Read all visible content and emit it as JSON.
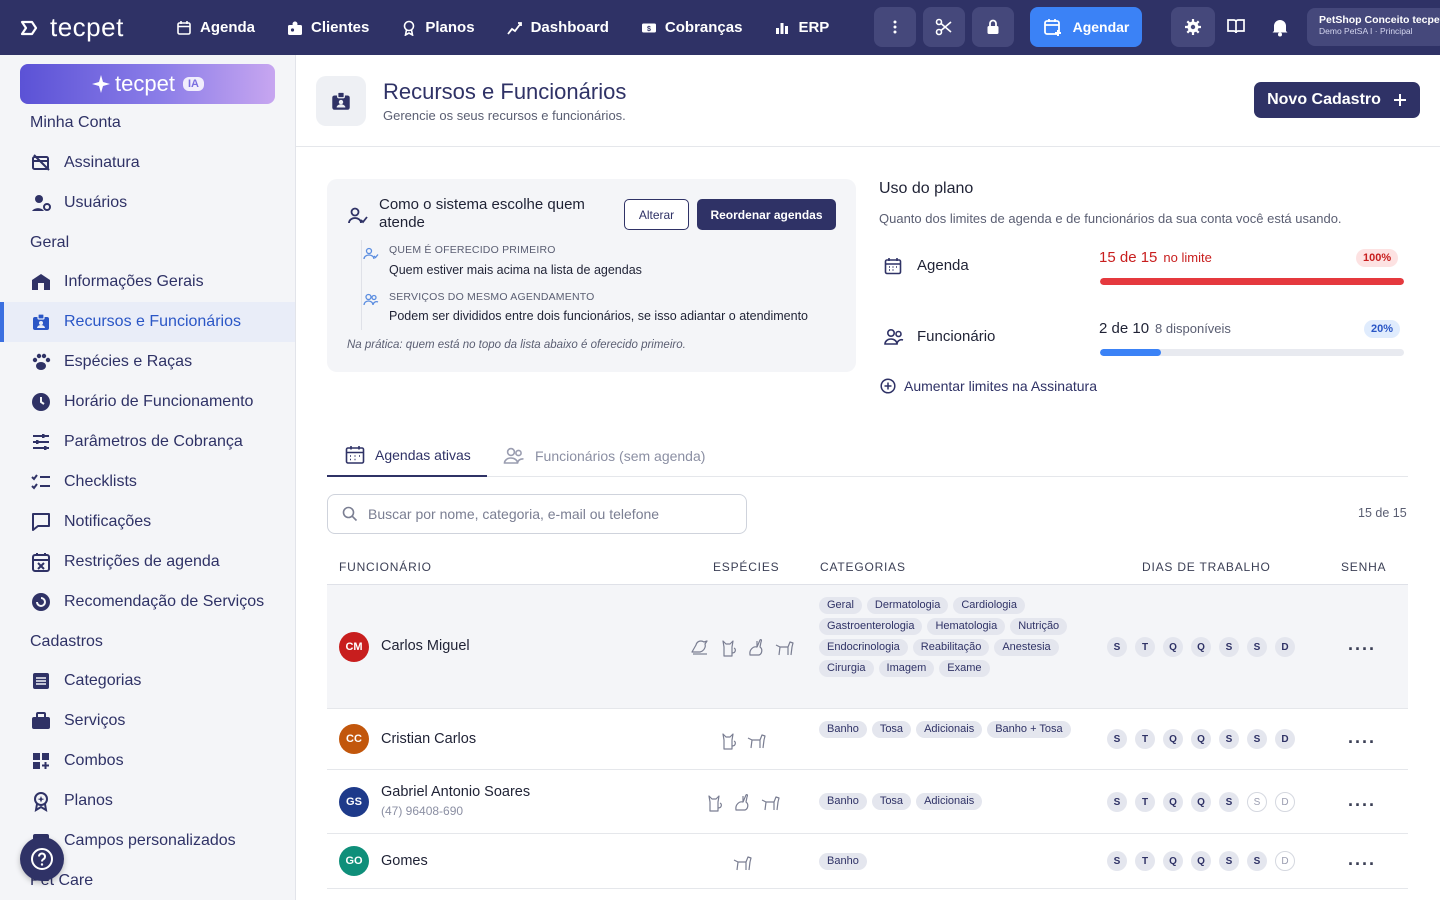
{
  "topbar": {
    "brand": "tecpet",
    "nav": [
      {
        "label": "Agenda",
        "icon": "calendar-icon"
      },
      {
        "label": "Clientes",
        "icon": "users-icon"
      },
      {
        "label": "Planos",
        "icon": "badge-icon"
      },
      {
        "label": "Dashboard",
        "icon": "chart-icon"
      },
      {
        "label": "Cobranças",
        "icon": "money-icon"
      },
      {
        "label": "ERP",
        "icon": "bars-icon"
      }
    ],
    "agendar_label": "Agendar",
    "account_name": "PetShop Conceito tecpet",
    "account_sub": "Demo PetSA I · Principal"
  },
  "sidebar": {
    "ia_brand": "tecpet",
    "ia_badge": "IA",
    "sections": [
      "Minha Conta",
      "Geral",
      "Cadastros",
      "Pet Care"
    ],
    "items": [
      {
        "label": "Assinatura"
      },
      {
        "label": "Usuários"
      },
      {
        "label": "Informações Gerais"
      },
      {
        "label": "Recursos e Funcionários"
      },
      {
        "label": "Espécies e Raças"
      },
      {
        "label": "Horário de Funcionamento"
      },
      {
        "label": "Parâmetros de Cobrança"
      },
      {
        "label": "Checklists"
      },
      {
        "label": "Notificações"
      },
      {
        "label": "Restrições de agenda"
      },
      {
        "label": "Recomendação de Serviços"
      },
      {
        "label": "Categorias"
      },
      {
        "label": "Serviços"
      },
      {
        "label": "Combos"
      },
      {
        "label": "Planos"
      },
      {
        "label": "Campos personalizados"
      }
    ]
  },
  "header": {
    "title": "Recursos e Funcionários",
    "subtitle": "Gerencie os seus recursos e funcionários.",
    "new_button": "Novo Cadastro"
  },
  "info": {
    "title": "Como o sistema escolhe quem atende",
    "alterar": "Alterar",
    "reordenar": "Reordenar agendas",
    "rows": [
      {
        "label": "QUEM É OFERECIDO PRIMEIRO",
        "value": "Quem estiver mais acima na lista de agendas"
      },
      {
        "label": "SERVIÇOS DO MESMO AGENDAMENTO",
        "value": "Podem ser divididos entre dois funcionários, se isso adiantar o atendimento"
      }
    ],
    "note": "Na prática: quem está no topo da lista abaixo é oferecido primeiro."
  },
  "plan": {
    "title": "Uso do plano",
    "subtitle": "Quanto dos limites de agenda e de funcionários da sua conta você está usando.",
    "rows": [
      {
        "label": "Agenda",
        "count": "15 de 15",
        "note": "no limite",
        "badge": "100%",
        "fraction": 1.0,
        "color": "#e5393e"
      },
      {
        "label": "Funcionário",
        "count": "2 de 10",
        "note": "8 disponíveis",
        "badge": "20%",
        "fraction": 0.2,
        "color": "#3b82f6"
      }
    ],
    "link": "Aumentar limites na Assinatura"
  },
  "tabs": [
    {
      "label": "Agendas ativas",
      "active": true
    },
    {
      "label": "Funcionários (sem agenda)",
      "active": false
    }
  ],
  "search": {
    "placeholder": "Buscar por nome, categoria, e-mail ou telefone",
    "value": ""
  },
  "count_label": "15 de 15",
  "table": {
    "headers": [
      "FUNCIONÁRIO",
      "ESPÉCIES",
      "CATEGORIAS",
      "DIAS DE TRABALHO",
      "SENHA"
    ],
    "day_letters": [
      "S",
      "T",
      "Q",
      "Q",
      "S",
      "S",
      "D"
    ],
    "rows": [
      {
        "initials": "CM",
        "avatar_color": "#c81e1e",
        "name": "Carlos Miguel",
        "phone": "",
        "species": [
          "bird-icon",
          "cat-icon",
          "rabbit-icon",
          "dog-icon"
        ],
        "categories": [
          "Geral",
          "Dermatologia",
          "Cardiologia",
          "Gastroenterologia",
          "Hematologia",
          "Nutrição",
          "Endocrinologia",
          "Reabilitação",
          "Anestesia",
          "Cirurgia",
          "Imagem",
          "Exame"
        ],
        "days_on": [
          true,
          true,
          true,
          true,
          true,
          true,
          true
        ],
        "more": "...."
      },
      {
        "initials": "CC",
        "avatar_color": "#c2570c",
        "name": "Cristian Carlos",
        "phone": "",
        "species": [
          "cat-icon",
          "dog-icon"
        ],
        "categories": [
          "Banho",
          "Tosa",
          "Adicionais",
          "Banho + Tosa"
        ],
        "days_on": [
          true,
          true,
          true,
          true,
          true,
          true,
          true
        ],
        "more": "...."
      },
      {
        "initials": "GS",
        "avatar_color": "#1e3a8a",
        "name": "Gabriel Antonio Soares",
        "phone": "(47) 96408-690",
        "species": [
          "cat-icon",
          "rabbit-icon",
          "dog-icon"
        ],
        "categories": [
          "Banho",
          "Tosa",
          "Adicionais"
        ],
        "days_on": [
          true,
          true,
          true,
          true,
          true,
          false,
          false
        ],
        "more": "...."
      },
      {
        "initials": "GO",
        "avatar_color": "#0f8f7a",
        "name": "Gomes",
        "phone": "",
        "species": [
          "dog-icon"
        ],
        "categories": [
          "Banho"
        ],
        "days_on": [
          true,
          true,
          true,
          true,
          true,
          true,
          false
        ],
        "more": "...."
      }
    ]
  }
}
